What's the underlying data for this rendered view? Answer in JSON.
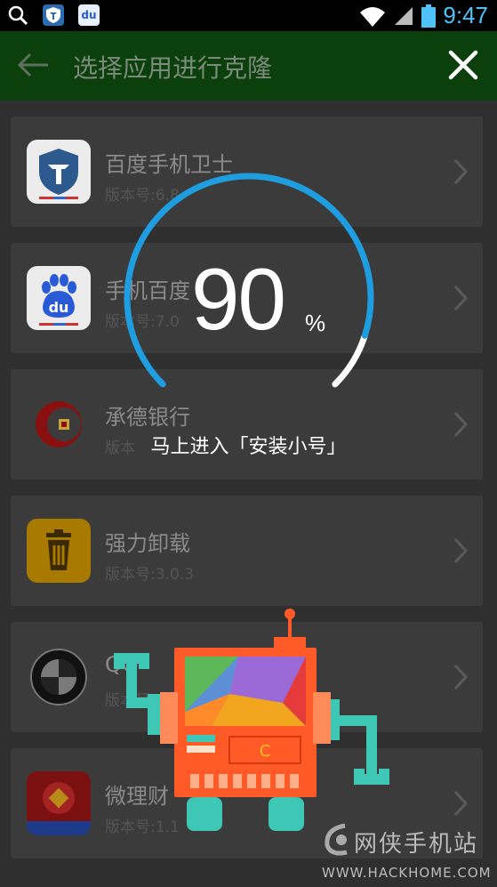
{
  "status_bar": {
    "time": "9:47",
    "icons": [
      "search-icon",
      "shield-app-icon",
      "baidu-app-icon",
      "wifi-icon",
      "signal-icon",
      "battery-icon"
    ]
  },
  "app_bar": {
    "title": "选择应用进行克隆",
    "back_icon": "arrow-left-icon",
    "close_icon": "close-icon",
    "color": "#0b3f0b"
  },
  "apps": [
    {
      "name": "百度手机卫士",
      "version": "版本号:6.8",
      "icon": "baidu-guard-shield-icon"
    },
    {
      "name": "手机百度",
      "version": "版本号:7.0",
      "icon": "baidu-paw-icon"
    },
    {
      "name": "承德银行",
      "version": "版本",
      "icon": "chengde-bank-icon"
    },
    {
      "name": "强力卸载",
      "version": "版本号:3.0.3",
      "icon": "trash-can-icon"
    },
    {
      "name": "QQ",
      "version": "版本号:1",
      "icon": "bmw-logo-icon"
    },
    {
      "name": "微理财",
      "version": "版本号:1.1",
      "icon": "red-envelope-icon"
    }
  ],
  "progress": {
    "percent": 90,
    "value_text": "90",
    "unit": "%",
    "message": "马上进入「安装小号」",
    "ring_color": "#1e9ee0"
  },
  "robot": {
    "chest_letter": "C",
    "body_color": "#ff5a28",
    "limb_color": "#3ec7b4"
  },
  "watermark": {
    "top": "网侠手机站",
    "bottom": "WWW.HACKHOME.COM"
  }
}
